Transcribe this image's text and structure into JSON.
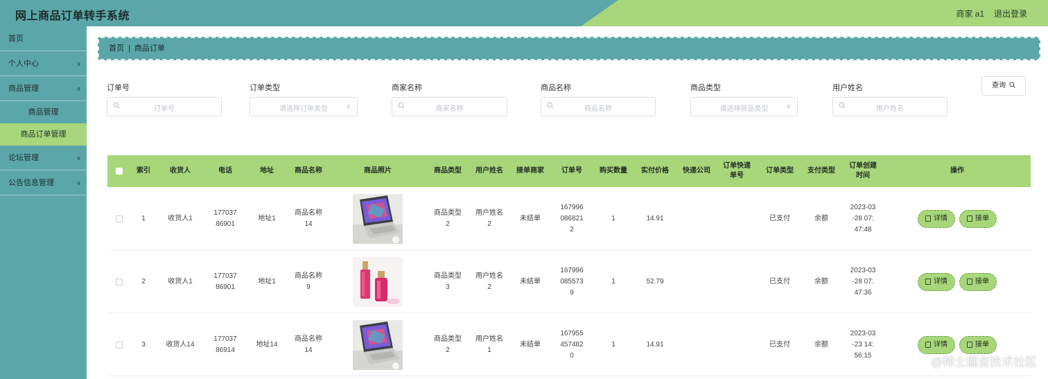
{
  "header": {
    "title": "网上商品订单转手系统",
    "user": "商家 a1",
    "logout": "退出登录"
  },
  "sidebar": {
    "items": [
      {
        "label": "首页"
      },
      {
        "label": "个人中心"
      },
      {
        "label": "商品管理"
      },
      {
        "label": "商品管理"
      },
      {
        "label": "商品订单管理"
      },
      {
        "label": "论坛管理"
      },
      {
        "label": "公告信息管理"
      }
    ]
  },
  "breadcrumb": {
    "home": "首页",
    "current": "商品订单"
  },
  "filters": [
    {
      "label": "订单号",
      "placeholder": "订单号"
    },
    {
      "label": "订单类型",
      "placeholder": "请选择订单类型"
    },
    {
      "label": "商家名称",
      "placeholder": "商家名称"
    },
    {
      "label": "商品名称",
      "placeholder": "商品名称"
    },
    {
      "label": "商品类型",
      "placeholder": "请选择商品类型"
    },
    {
      "label": "用户姓名",
      "placeholder": "用户姓名"
    }
  ],
  "query_label": "查询",
  "table": {
    "headers": [
      "索引",
      "收货人",
      "电话",
      "地址",
      "商品名称",
      "商品照片",
      "商品类型",
      "用户姓名",
      "接单商家",
      "订单号",
      "购买数量",
      "实付价格",
      "快递公司",
      "订单快递单号",
      "订单类型",
      "支付类型",
      "订单创建时间",
      "操作"
    ],
    "rows": [
      {
        "index": "1",
        "receiver": "收货人1",
        "phone": "17703786901",
        "address": "地址1",
        "product": "商品名称14",
        "photo": "laptop",
        "ptype": "商品类型2",
        "uname": "用户姓名2",
        "merchant": "未结单",
        "order_no": "1679960868212",
        "qty": "1",
        "price": "14.91",
        "courier": "",
        "tracking": "",
        "otype": "已支付",
        "paytype": "余额",
        "created": "2023-03-28 07:47:48"
      },
      {
        "index": "2",
        "receiver": "收货人1",
        "phone": "17703786901",
        "address": "地址1",
        "product": "商品名称9",
        "photo": "bottles",
        "ptype": "商品类型3",
        "uname": "用户姓名2",
        "merchant": "未结单",
        "order_no": "1679960855739",
        "qty": "1",
        "price": "52.79",
        "courier": "",
        "tracking": "",
        "otype": "已支付",
        "paytype": "余额",
        "created": "2023-03-28 07:47:36"
      },
      {
        "index": "3",
        "receiver": "收货人14",
        "phone": "17703786914",
        "address": "地址14",
        "product": "商品名称14",
        "photo": "laptop",
        "ptype": "商品类型2",
        "uname": "用户姓名1",
        "merchant": "未结单",
        "order_no": "1679554574820",
        "qty": "1",
        "price": "14.91",
        "courier": "",
        "tracking": "",
        "otype": "已支付",
        "paytype": "余额",
        "created": "2023-03-23 14:56:15"
      }
    ],
    "actions": {
      "detail": "详情",
      "accept": "接单"
    }
  },
  "watermark": "@稀土掘金技术社区",
  "colors": {
    "teal": "#5ba6a9",
    "green": "#a8d67b"
  }
}
